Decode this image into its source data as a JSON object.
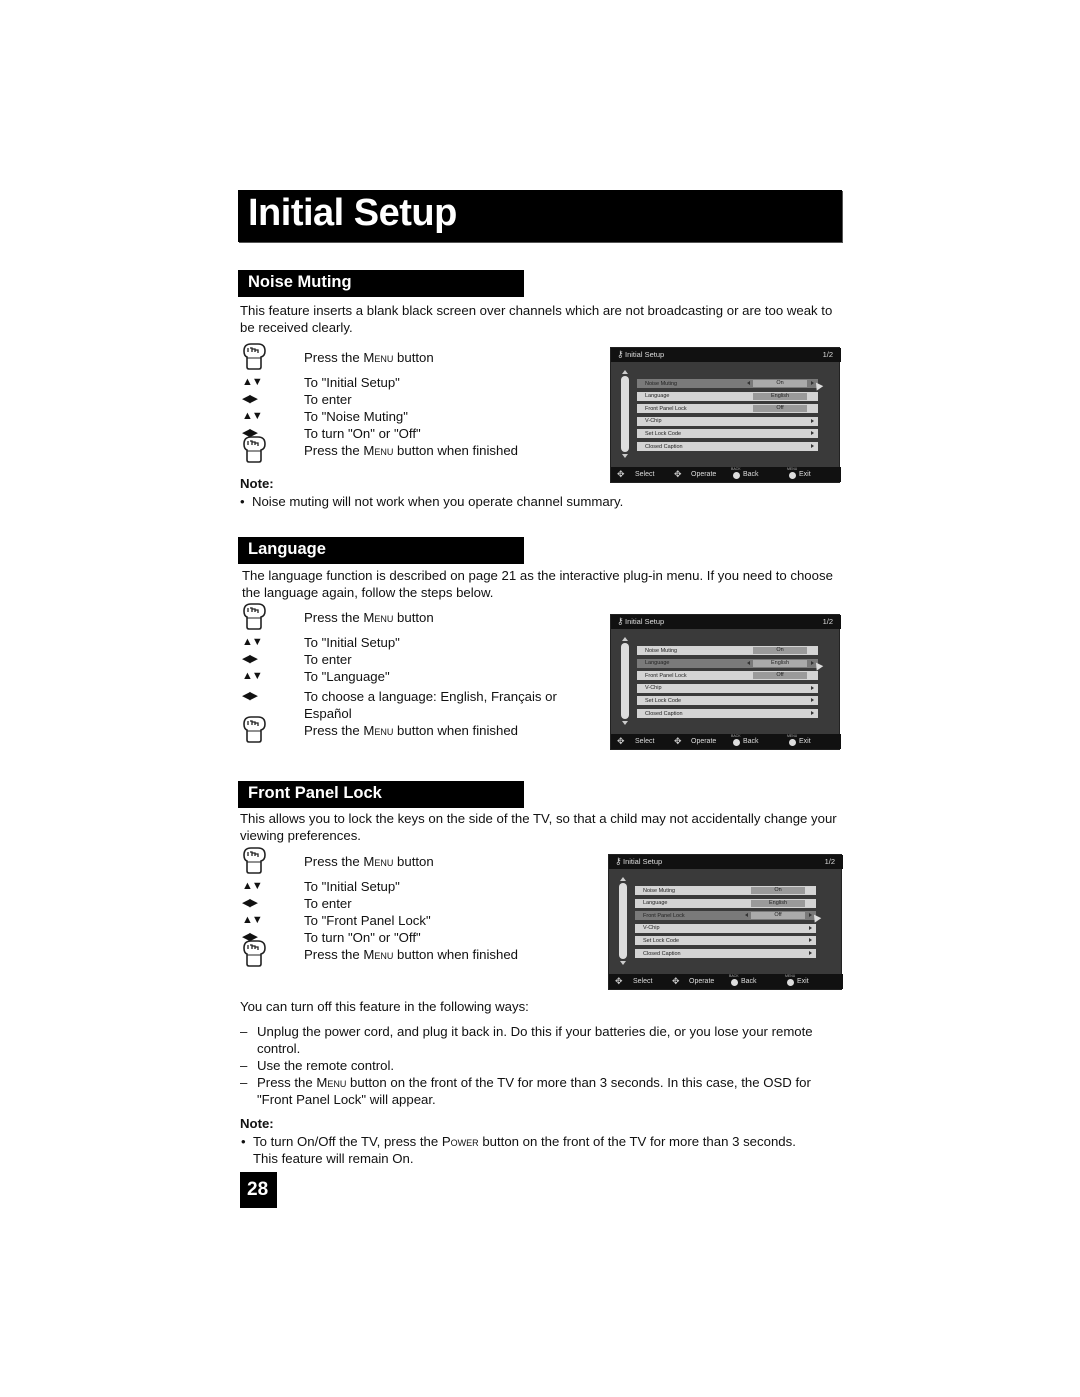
{
  "page": {
    "title": "Initial Setup",
    "page_number": "28"
  },
  "common": {
    "menu_word": "Menu",
    "power_word": "Power"
  },
  "noise_muting": {
    "heading": "Noise Muting",
    "intro": "This feature inserts a blank black screen over channels which are not broadcasting or are too weak to be received clearly.",
    "steps": [
      {
        "icon": "hand-press-icon",
        "pre": "Press the ",
        "caps": "Menu",
        "post": " button"
      },
      {
        "icon": "up-down-arrows-icon",
        "text": "To \"Initial Setup\""
      },
      {
        "icon": "left-right-arrows-icon",
        "text": "To enter"
      },
      {
        "icon": "up-down-arrows-icon",
        "text": "To \"Noise Muting\""
      },
      {
        "icon": "left-right-arrows-icon",
        "text": "To turn \"On\" or \"Off\""
      },
      {
        "icon": "hand-press-icon",
        "pre": "Press the ",
        "caps": "Menu",
        "post": " button when finished"
      }
    ],
    "note_label": "Note:",
    "note": "Noise muting will not work when you operate channel summary."
  },
  "language": {
    "heading": "Language",
    "intro": "The language function is described on page 21 as the interactive plug-in menu.  If you need to choose the language again, follow the steps below.",
    "steps": [
      {
        "icon": "hand-press-icon",
        "pre": "Press the ",
        "caps": "Menu",
        "post": " button"
      },
      {
        "icon": "up-down-arrows-icon",
        "text": "To \"Initial Setup\""
      },
      {
        "icon": "left-right-arrows-icon",
        "text": "To enter"
      },
      {
        "icon": "up-down-arrows-icon",
        "text": "To \"Language\""
      },
      {
        "icon": "left-right-arrows-icon",
        "text": "To choose a language: English, Français or",
        "text2": "Español"
      },
      {
        "icon": "hand-press-icon",
        "pre": "Press the ",
        "caps": "Menu",
        "post": " button when finished"
      }
    ]
  },
  "front_panel_lock": {
    "heading": "Front Panel Lock",
    "intro": "This allows you to lock the keys on the side of the TV, so that a child may not accidentally change your viewing preferences.",
    "steps": [
      {
        "icon": "hand-press-icon",
        "pre": "Press the ",
        "caps": "Menu",
        "post": " button"
      },
      {
        "icon": "up-down-arrows-icon",
        "text": "To \"Initial Setup\""
      },
      {
        "icon": "left-right-arrows-icon",
        "text": "To enter"
      },
      {
        "icon": "up-down-arrows-icon",
        "text": "To \"Front Panel Lock\""
      },
      {
        "icon": "left-right-arrows-icon",
        "text": "To turn \"On\" or \"Off\""
      },
      {
        "icon": "hand-press-icon",
        "pre": "Press the ",
        "caps": "Menu",
        "post": " button when finished"
      }
    ],
    "turn_off_intro": "You can turn off this feature in the following ways:",
    "ways": [
      "Unplug the power cord, and plug it back in. Do this if your batteries die, or you lose your remote control.",
      "Use the remote control.",
      {
        "pre": "Press the ",
        "caps": "Menu",
        "post": " button on the front of the TV for more than 3 seconds. In this case, the OSD for \"Front Panel Lock\" will appear."
      }
    ],
    "note_label": "Note:",
    "note": {
      "pre": "To turn On/Off the TV, press the ",
      "caps": "Power",
      "post": " button on the front of the TV for more than 3 seconds. This feature will remain On."
    }
  },
  "osd": {
    "title": "Initial Setup",
    "page": "1/2",
    "items": [
      {
        "label": "Noise Muting",
        "value": "On"
      },
      {
        "label": "Language",
        "value": "English"
      },
      {
        "label": "Front Panel Lock",
        "value": "Off"
      },
      {
        "label": "V-Chip",
        "value": null
      },
      {
        "label": "Set Lock Code",
        "value": null
      },
      {
        "label": "Closed Caption",
        "value": null
      }
    ],
    "footer": {
      "select": "Select",
      "operate": "Operate",
      "back": "Back",
      "back_key": "BACK",
      "exit": "Exit",
      "exit_key": "MENU"
    },
    "screens": [
      {
        "section": "noise_muting",
        "selected_index": 0
      },
      {
        "section": "language",
        "selected_index": 1
      },
      {
        "section": "front_panel_lock",
        "selected_index": 2
      }
    ]
  }
}
